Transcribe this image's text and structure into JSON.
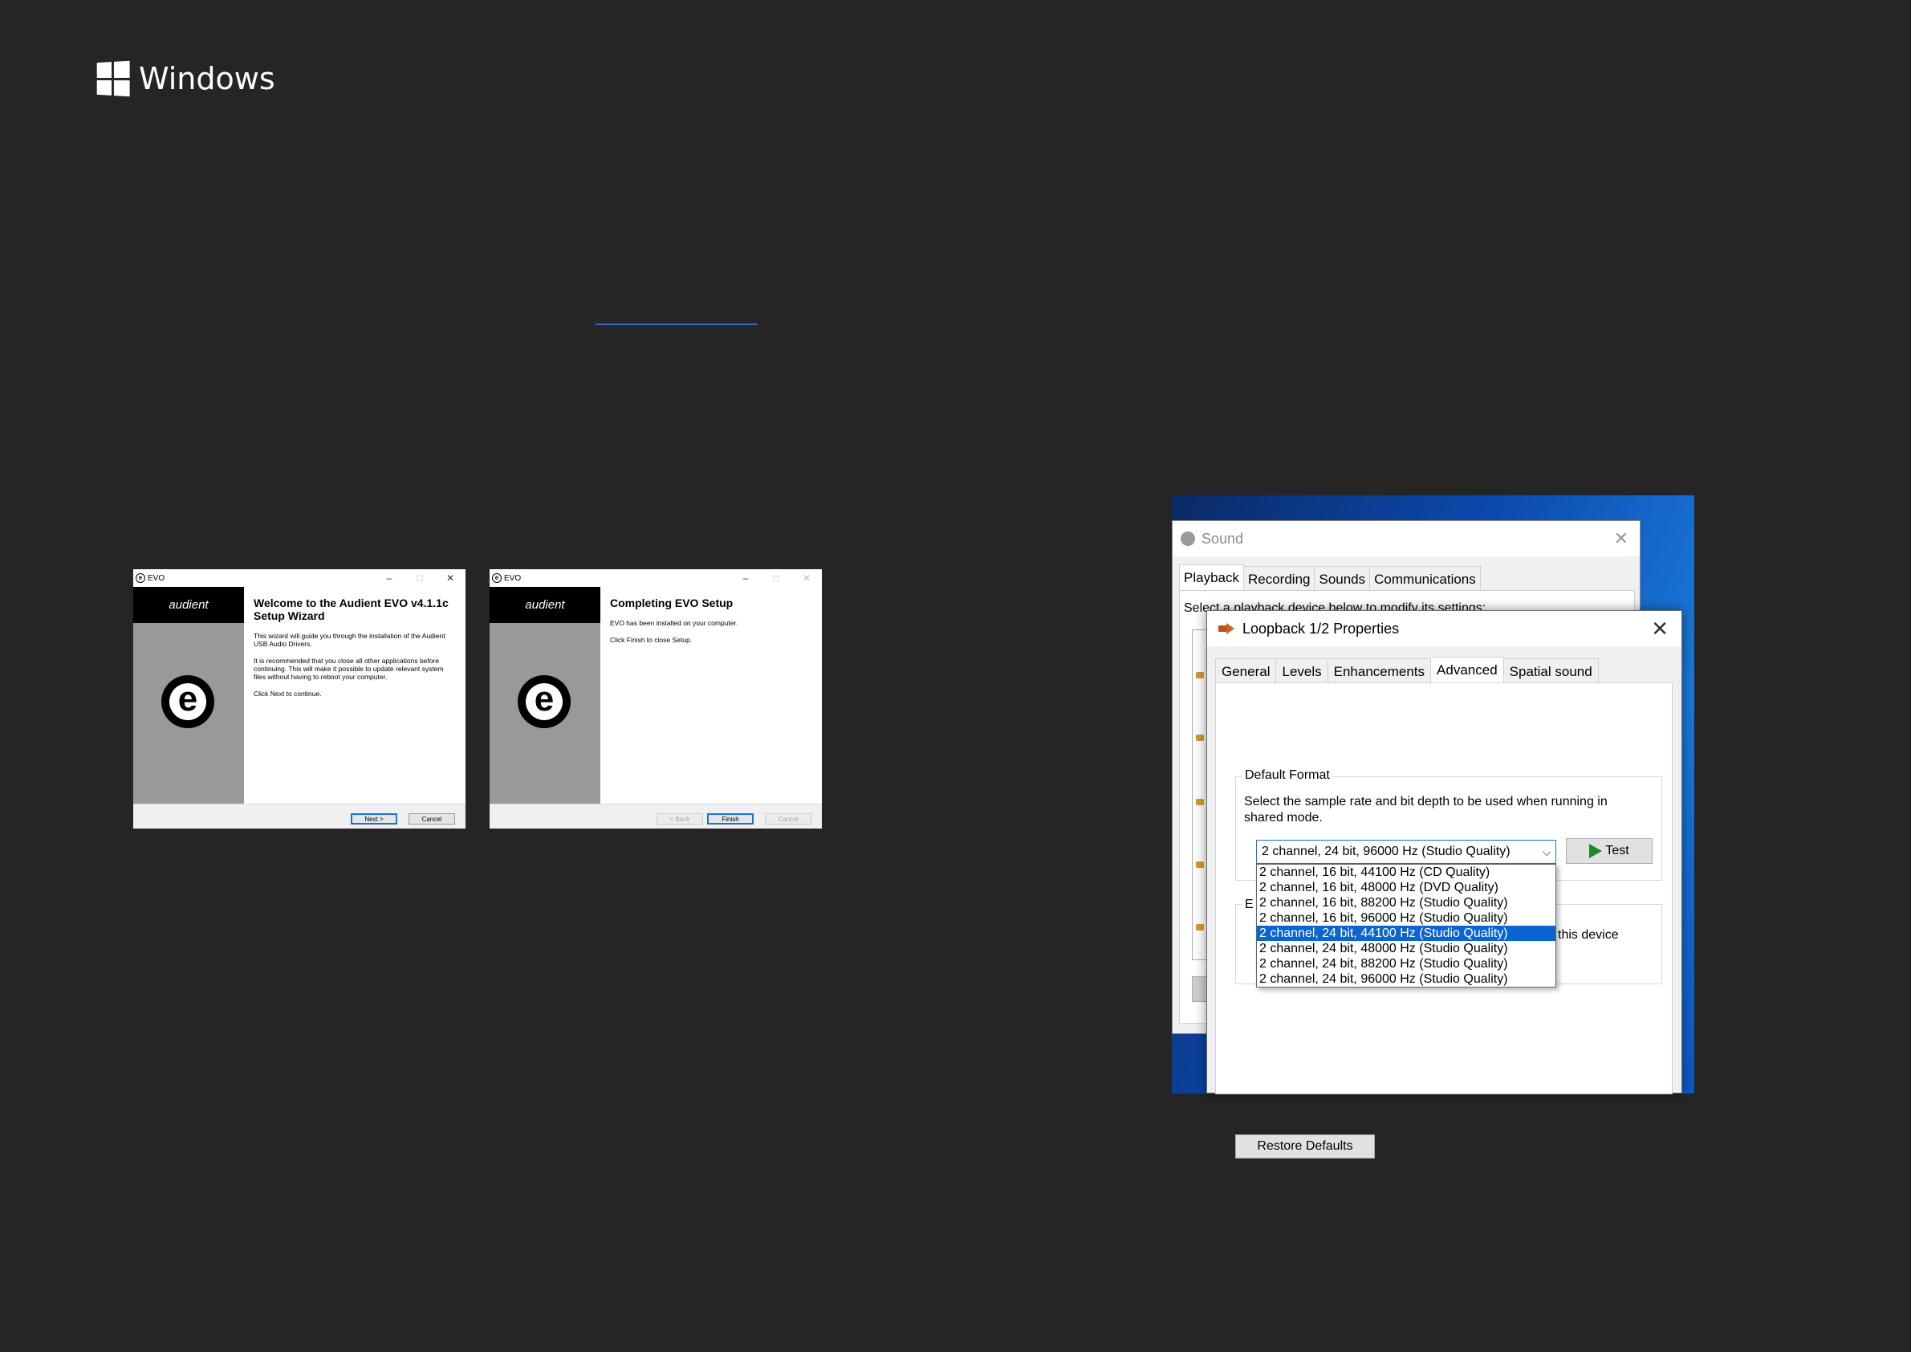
{
  "brand": {
    "word": "Windows"
  },
  "wizard_welcome": {
    "window_title": "EVO",
    "app_icon": "e",
    "brand_band": "audient",
    "logo_letter": "e",
    "heading": "Welcome to the Audient EVO v4.1.1c Setup Wizard",
    "para1": "This wizard will guide you through the installation of the Audient USB Audio Drivers.",
    "para2": "It is recommended that you close all other applications before continuing. This will make it possible to update relevant system files without having to reboot your computer.",
    "para3": "Click Next to continue.",
    "next_label": "Next >",
    "cancel_label": "Cancel",
    "minimize": "–",
    "maximize": "□",
    "close": "✕"
  },
  "wizard_complete": {
    "window_title": "EVO",
    "app_icon": "e",
    "brand_band": "audient",
    "logo_letter": "e",
    "heading": "Completing EVO Setup",
    "para1": "EVO has been installed on your computer.",
    "para2": "Click Finish to close Setup.",
    "back_label": "< Back",
    "finish_label": "Finish",
    "cancel_label": "Cancel",
    "minimize": "–",
    "maximize": "□",
    "close": "✕"
  },
  "sound": {
    "title": "Sound",
    "close": "✕",
    "tabs": [
      "Playback",
      "Recording",
      "Sounds",
      "Communications"
    ],
    "selected_tab": "Playback",
    "hint": "Select a playback device below to modify its settings:"
  },
  "props": {
    "title": "Loopback 1/2 Properties",
    "close": "✕",
    "tabs": [
      "General",
      "Levels",
      "Enhancements",
      "Advanced",
      "Spatial sound"
    ],
    "selected_tab": "Advanced",
    "default_format": {
      "legend": "Default Format",
      "description": "Select the sample rate and bit depth to be used when running in shared mode.",
      "selected_value": "2 channel, 24 bit, 96000 Hz (Studio Quality)",
      "caret": "⌵",
      "test_label": "Test",
      "options": [
        "2 channel, 16 bit, 44100 Hz (CD Quality)",
        "2 channel, 16 bit, 48000 Hz (DVD Quality)",
        "2 channel, 16 bit, 88200 Hz (Studio Quality)",
        "2 channel, 16 bit, 96000 Hz (Studio Quality)",
        "2 channel, 24 bit, 44100 Hz (Studio Quality)",
        "2 channel, 24 bit, 48000 Hz (Studio Quality)",
        "2 channel, 24 bit, 88200 Hz (Studio Quality)",
        "2 channel, 24 bit, 96000 Hz (Studio Quality)"
      ],
      "highlighted_index": 4
    },
    "exclusive": {
      "legend": "E",
      "tail_text": "this device"
    },
    "restore_label": "Restore Defaults"
  },
  "colors": {
    "background": "#252525",
    "accent": "#0a64d2",
    "link_underline": "#2b6fc9"
  }
}
